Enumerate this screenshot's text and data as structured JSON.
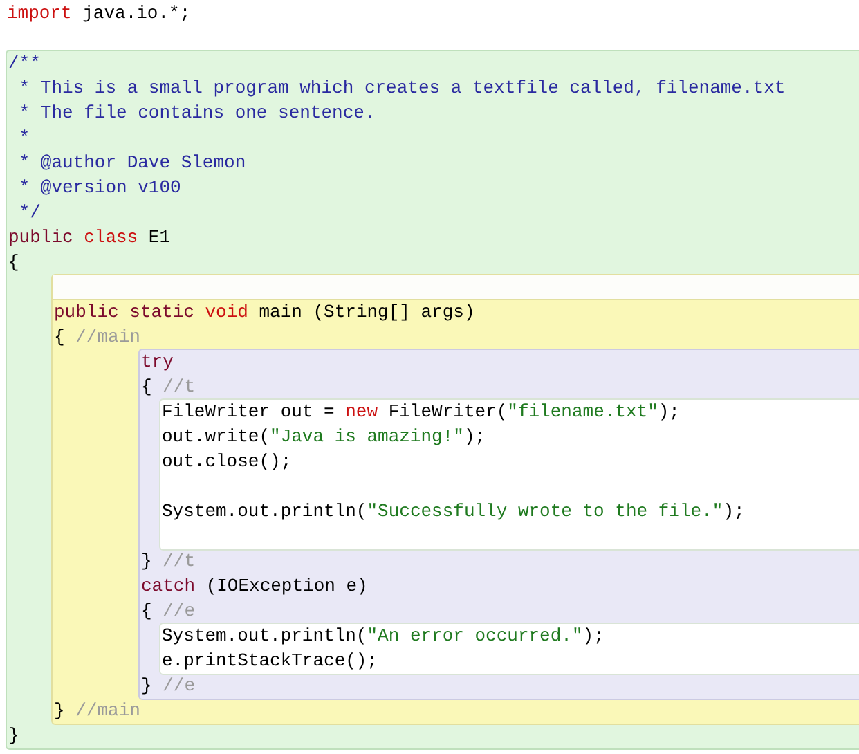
{
  "editor": {
    "code": [
      {
        "kind": "line",
        "tokens": [
          {
            "kind": "keyword",
            "text": "import"
          },
          {
            "kind": "plain",
            "text": " java.io.*;"
          }
        ]
      },
      {
        "kind": "blank"
      },
      {
        "kind": "class_scope",
        "children": [
          {
            "kind": "line",
            "tokens": [
              {
                "kind": "doc",
                "text": "/**"
              }
            ]
          },
          {
            "kind": "line",
            "tokens": [
              {
                "kind": "doc",
                "text": " * This is a small program which creates a textfile called, filename.txt"
              }
            ]
          },
          {
            "kind": "line",
            "tokens": [
              {
                "kind": "doc",
                "text": " * The file contains one sentence."
              }
            ]
          },
          {
            "kind": "line",
            "tokens": [
              {
                "kind": "doc",
                "text": " *"
              }
            ]
          },
          {
            "kind": "line",
            "tokens": [
              {
                "kind": "doc",
                "text": " * @author Dave Slemon"
              }
            ]
          },
          {
            "kind": "line",
            "tokens": [
              {
                "kind": "doc",
                "text": " * @version v100"
              }
            ]
          },
          {
            "kind": "line",
            "tokens": [
              {
                "kind": "doc",
                "text": " */"
              }
            ]
          },
          {
            "kind": "line",
            "tokens": [
              {
                "kind": "modifier",
                "text": "public "
              },
              {
                "kind": "keyword",
                "text": "class"
              },
              {
                "kind": "plain",
                "text": " E1"
              }
            ]
          },
          {
            "kind": "line",
            "tokens": [
              {
                "kind": "plain",
                "text": "{"
              }
            ]
          },
          {
            "kind": "method_scope",
            "children": [
              {
                "kind": "line",
                "tokens": [
                  {
                    "kind": "modifier",
                    "text": "public static "
                  },
                  {
                    "kind": "keyword",
                    "text": "void"
                  },
                  {
                    "kind": "plain",
                    "text": " main (String[] args)"
                  }
                ]
              },
              {
                "kind": "line",
                "tokens": [
                  {
                    "kind": "plain",
                    "text": "{ "
                  },
                  {
                    "kind": "comment",
                    "text": "//main"
                  }
                ]
              },
              {
                "kind": "try_scope",
                "children": [
                  {
                    "kind": "line",
                    "tokens": [
                      {
                        "kind": "modifier",
                        "text": "try"
                      }
                    ]
                  },
                  {
                    "kind": "line",
                    "tokens": [
                      {
                        "kind": "plain",
                        "text": "{ "
                      },
                      {
                        "kind": "comment",
                        "text": "//t"
                      }
                    ]
                  },
                  {
                    "kind": "body_scope",
                    "children": [
                      {
                        "kind": "line",
                        "tokens": [
                          {
                            "kind": "plain",
                            "text": "FileWriter out = "
                          },
                          {
                            "kind": "keyword",
                            "text": "new"
                          },
                          {
                            "kind": "plain",
                            "text": " FileWriter("
                          },
                          {
                            "kind": "string",
                            "text": "\"filename.txt\""
                          },
                          {
                            "kind": "plain",
                            "text": ");"
                          }
                        ]
                      },
                      {
                        "kind": "line",
                        "tokens": [
                          {
                            "kind": "plain",
                            "text": "out.write("
                          },
                          {
                            "kind": "string",
                            "text": "\"Java is amazing!\""
                          },
                          {
                            "kind": "plain",
                            "text": ");"
                          }
                        ]
                      },
                      {
                        "kind": "line",
                        "tokens": [
                          {
                            "kind": "plain",
                            "text": "out.close();"
                          }
                        ]
                      },
                      {
                        "kind": "blank"
                      },
                      {
                        "kind": "line",
                        "tokens": [
                          {
                            "kind": "plain",
                            "text": "System.out.println("
                          },
                          {
                            "kind": "string",
                            "text": "\"Successfully wrote to the file.\""
                          },
                          {
                            "kind": "plain",
                            "text": ");"
                          }
                        ]
                      },
                      {
                        "kind": "blank"
                      }
                    ]
                  },
                  {
                    "kind": "line",
                    "tokens": [
                      {
                        "kind": "plain",
                        "text": "} "
                      },
                      {
                        "kind": "comment",
                        "text": "//t"
                      }
                    ]
                  },
                  {
                    "kind": "line",
                    "tokens": [
                      {
                        "kind": "modifier",
                        "text": "catch"
                      },
                      {
                        "kind": "plain",
                        "text": " (IOException e)"
                      }
                    ]
                  },
                  {
                    "kind": "line",
                    "tokens": [
                      {
                        "kind": "plain",
                        "text": "{ "
                      },
                      {
                        "kind": "comment",
                        "text": "//e"
                      }
                    ]
                  },
                  {
                    "kind": "body_scope",
                    "children": [
                      {
                        "kind": "line",
                        "tokens": [
                          {
                            "kind": "plain",
                            "text": "System.out.println("
                          },
                          {
                            "kind": "string",
                            "text": "\"An error occurred.\""
                          },
                          {
                            "kind": "plain",
                            "text": ");"
                          }
                        ]
                      },
                      {
                        "kind": "line",
                        "tokens": [
                          {
                            "kind": "plain",
                            "text": "e.printStackTrace();"
                          }
                        ]
                      }
                    ]
                  },
                  {
                    "kind": "line",
                    "tokens": [
                      {
                        "kind": "plain",
                        "text": "} "
                      },
                      {
                        "kind": "comment",
                        "text": "//e"
                      }
                    ]
                  }
                ]
              },
              {
                "kind": "line",
                "tokens": [
                  {
                    "kind": "plain",
                    "text": "} "
                  },
                  {
                    "kind": "comment",
                    "text": "//main"
                  }
                ]
              }
            ]
          },
          {
            "kind": "line",
            "tokens": [
              {
                "kind": "plain",
                "text": "}"
              }
            ]
          }
        ]
      }
    ]
  }
}
